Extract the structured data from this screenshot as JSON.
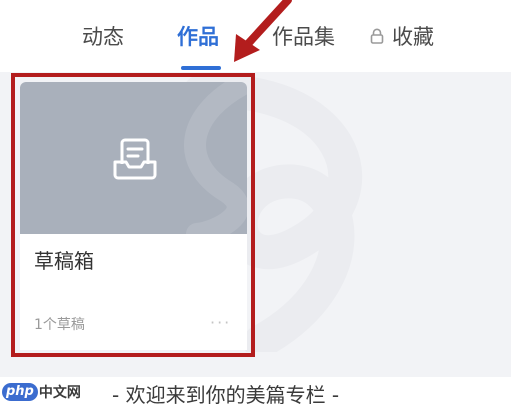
{
  "tabs": [
    {
      "label": "动态",
      "active": false
    },
    {
      "label": "作品",
      "active": true
    },
    {
      "label": "作品集",
      "active": false
    },
    {
      "label": "收藏",
      "active": false,
      "locked": true
    }
  ],
  "draft_card": {
    "title": "草稿箱",
    "count": "1个草稿",
    "more": "···"
  },
  "footer": {
    "welcome": "- 欢迎来到你的美篇专栏 -"
  },
  "watermark": {
    "badge": "php",
    "text": "中文网"
  },
  "colors": {
    "accent": "#2f6fd6",
    "highlight": "#b31d1d",
    "background": "#f2f3f6"
  }
}
